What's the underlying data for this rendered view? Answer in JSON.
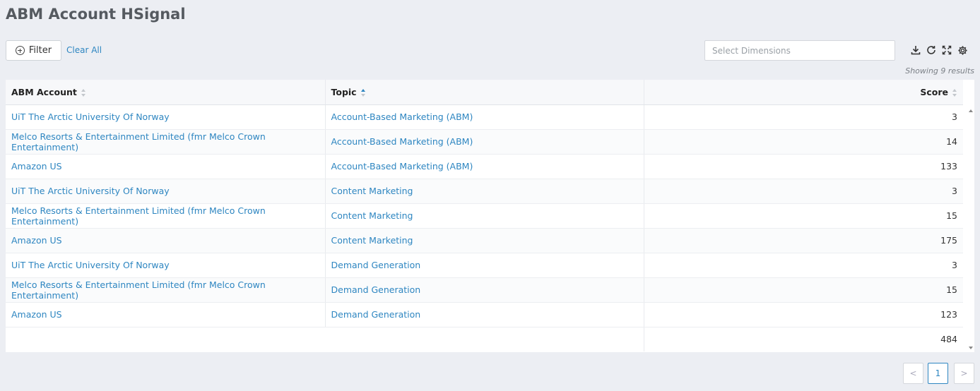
{
  "page": {
    "title": "ABM Account HSignal"
  },
  "toolbar": {
    "filter_label": "Filter",
    "clear_all_label": "Clear All",
    "dimensions_placeholder": "Select Dimensions",
    "icons": [
      "download-icon",
      "refresh-icon",
      "expand-icon",
      "settings-icon"
    ]
  },
  "results": {
    "showing_text": "Showing 9 results"
  },
  "table": {
    "headers": {
      "account": "ABM Account",
      "topic": "Topic",
      "score": "Score"
    },
    "sort": {
      "column": "Topic",
      "direction": "ascending"
    },
    "rows": [
      {
        "account": "UiT The Arctic University Of Norway",
        "topic": "Account-Based Marketing (ABM)",
        "score": "3"
      },
      {
        "account": "Melco Resorts & Entertainment Limited (fmr Melco Crown Entertainment)",
        "topic": "Account-Based Marketing (ABM)",
        "score": "14"
      },
      {
        "account": "Amazon US",
        "topic": "Account-Based Marketing (ABM)",
        "score": "133"
      },
      {
        "account": "UiT The Arctic University Of Norway",
        "topic": "Content Marketing",
        "score": "3"
      },
      {
        "account": "Melco Resorts & Entertainment Limited (fmr Melco Crown Entertainment)",
        "topic": "Content Marketing",
        "score": "15"
      },
      {
        "account": "Amazon US",
        "topic": "Content Marketing",
        "score": "175"
      },
      {
        "account": "UiT The Arctic University Of Norway",
        "topic": "Demand Generation",
        "score": "3"
      },
      {
        "account": "Melco Resorts & Entertainment Limited (fmr Melco Crown Entertainment)",
        "topic": "Demand Generation",
        "score": "15"
      },
      {
        "account": "Amazon US",
        "topic": "Demand Generation",
        "score": "123"
      }
    ],
    "total": "484"
  },
  "pagination": {
    "prev": "<",
    "current": "1",
    "next": ">"
  },
  "colors": {
    "link": "#2e86c1",
    "background": "#eceef3"
  }
}
